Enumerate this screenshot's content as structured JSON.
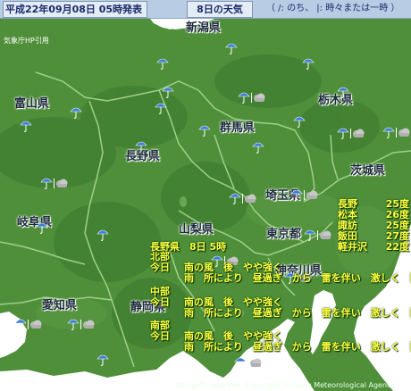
{
  "header": {
    "issued": "平成22年09月08日 05時発表",
    "forecast_day": "8日の天気",
    "legend_note": "（ /: のち、 |: 時々または一時 ）"
  },
  "credit_top": "気象庁HP引用",
  "prefectures": [
    {
      "name": "新潟県"
    },
    {
      "name": "富山県"
    },
    {
      "name": "栃木県"
    },
    {
      "name": "群馬県"
    },
    {
      "name": "長野県"
    },
    {
      "name": "茨城県"
    },
    {
      "name": "埼玉県"
    },
    {
      "name": "岐阜県"
    },
    {
      "name": "山梨県"
    },
    {
      "name": "東京都"
    },
    {
      "name": "神奈川県"
    },
    {
      "name": "愛知県"
    },
    {
      "name": "静岡県"
    }
  ],
  "weather_icons": [
    {
      "icon": "rain-icon"
    },
    {
      "icon": "rain-icon"
    },
    {
      "icon": "rain-icon"
    },
    {
      "icon": "rain-icon"
    },
    {
      "icon": "rain-icon"
    },
    {
      "icon": "rain-icon"
    },
    {
      "icon": "rain-icon"
    },
    {
      "icon": "rain-icon"
    },
    {
      "icon": "rain-sometimes-cloud-icon"
    },
    {
      "icon": "rain-icon"
    },
    {
      "icon": "rain-icon"
    },
    {
      "icon": "rain-icon"
    },
    {
      "icon": "rain-sometimes-cloud-icon"
    },
    {
      "icon": "rain-sometimes-cloud-icon"
    },
    {
      "icon": "rain-sometimes-cloud-icon"
    },
    {
      "icon": "rain-sometimes-cloud-icon"
    },
    {
      "icon": "rain-sometimes-cloud-icon"
    },
    {
      "icon": "rain-icon"
    },
    {
      "icon": "rain-icon"
    },
    {
      "icon": "rain-icon"
    },
    {
      "icon": "rain-sometimes-cloud-icon"
    },
    {
      "icon": "rain-sometimes-cloud-icon"
    },
    {
      "icon": "rain-sometimes-cloud-icon"
    },
    {
      "icon": "rain-icon"
    },
    {
      "icon": "rain-sometimes-cloud-icon"
    },
    {
      "icon": "rain-sometimes-cloud-icon"
    },
    {
      "icon": "rain-sometimes-cloud-icon"
    }
  ],
  "nagano_forecast": {
    "heading": "長野県　8日 5時",
    "regions": [
      {
        "name": "北部",
        "label": "今日",
        "wind": "南の風　後　やや強く",
        "weather": "雨　所により　昼過ぎ　から　雷を伴い　激しく　降る"
      },
      {
        "name": "中部",
        "label": "今日",
        "wind": "南の風　後　やや強く",
        "weather": "雨　所により　昼過ぎ　から　雷を伴い　激しく　降る"
      },
      {
        "name": "南部",
        "label": "今日",
        "wind": "南の風　後　やや強く",
        "weather": "雨　所により　昼過ぎ　から　雷を伴い　激しく　降る"
      }
    ]
  },
  "temperatures": [
    {
      "city": "長野",
      "temp": "25度"
    },
    {
      "city": "松本",
      "temp": "26度"
    },
    {
      "city": "諏訪",
      "temp": "25度"
    },
    {
      "city": "飯田",
      "temp": "27度"
    },
    {
      "city": "軽井沢",
      "temp": "22度"
    }
  ],
  "footer": "All rights reserved. Copyright © Japan Meteorological Agency",
  "colors": {
    "land": "#4f8f3a",
    "mountains": "#3f7a30",
    "sea": "#ffffff",
    "border": "#8ec07a",
    "header": "#b8cce4",
    "overlay_text": "#ffff40"
  }
}
